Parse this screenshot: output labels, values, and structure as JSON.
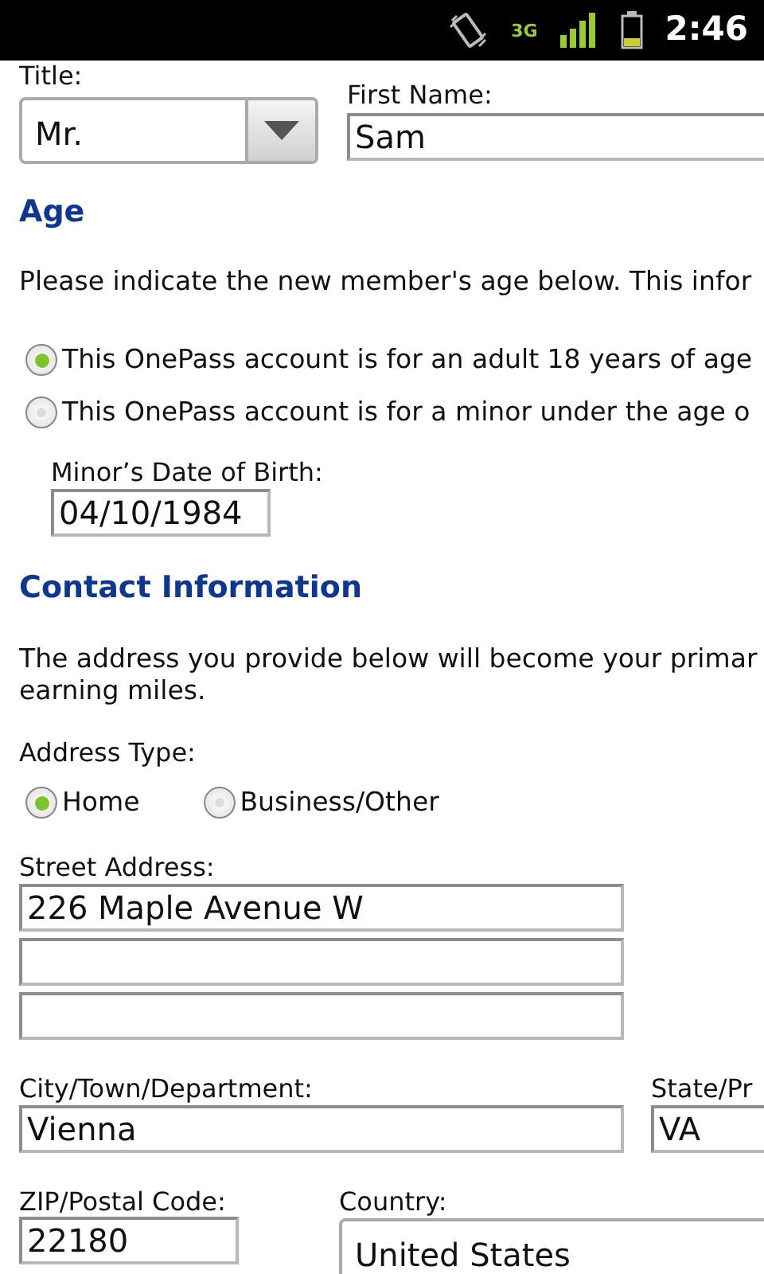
{
  "status_bar": {
    "network": "3G",
    "time": "2:46"
  },
  "title_field": {
    "label": "Title:",
    "value": "Mr."
  },
  "first_name": {
    "label": "First Name:",
    "value": "Sam"
  },
  "age": {
    "heading": "Age",
    "text": "Please indicate the new member's age below. This infor",
    "options": [
      {
        "label": "This OnePass account is for an adult 18 years of age",
        "selected": true
      },
      {
        "label": "This OnePass account is for a minor under the age o",
        "selected": false
      }
    ],
    "dob": {
      "label": "Minor’s Date of Birth:",
      "value": "04/10/1984"
    }
  },
  "contact": {
    "heading": "Contact Information",
    "text_lines": [
      "The address you provide below will become your primar",
      "earning miles."
    ],
    "address_type": {
      "label": "Address Type:",
      "options": [
        {
          "label": "Home",
          "selected": true
        },
        {
          "label": "Business/Other",
          "selected": false
        }
      ]
    },
    "street": {
      "label": "Street Address:",
      "fields": [
        {
          "kind": "text",
          "value": "226 Maple Avenue W"
        },
        {
          "kind": "blank"
        },
        {
          "kind": "blank"
        }
      ]
    },
    "city": {
      "label": "City/Town/Department:",
      "value": "Vienna"
    },
    "state": {
      "label": "State/Pr",
      "value": "VA"
    },
    "zip": {
      "label": "ZIP/Postal Code:",
      "value": "22180"
    },
    "country": {
      "label": "Country:",
      "value": "United States"
    }
  }
}
